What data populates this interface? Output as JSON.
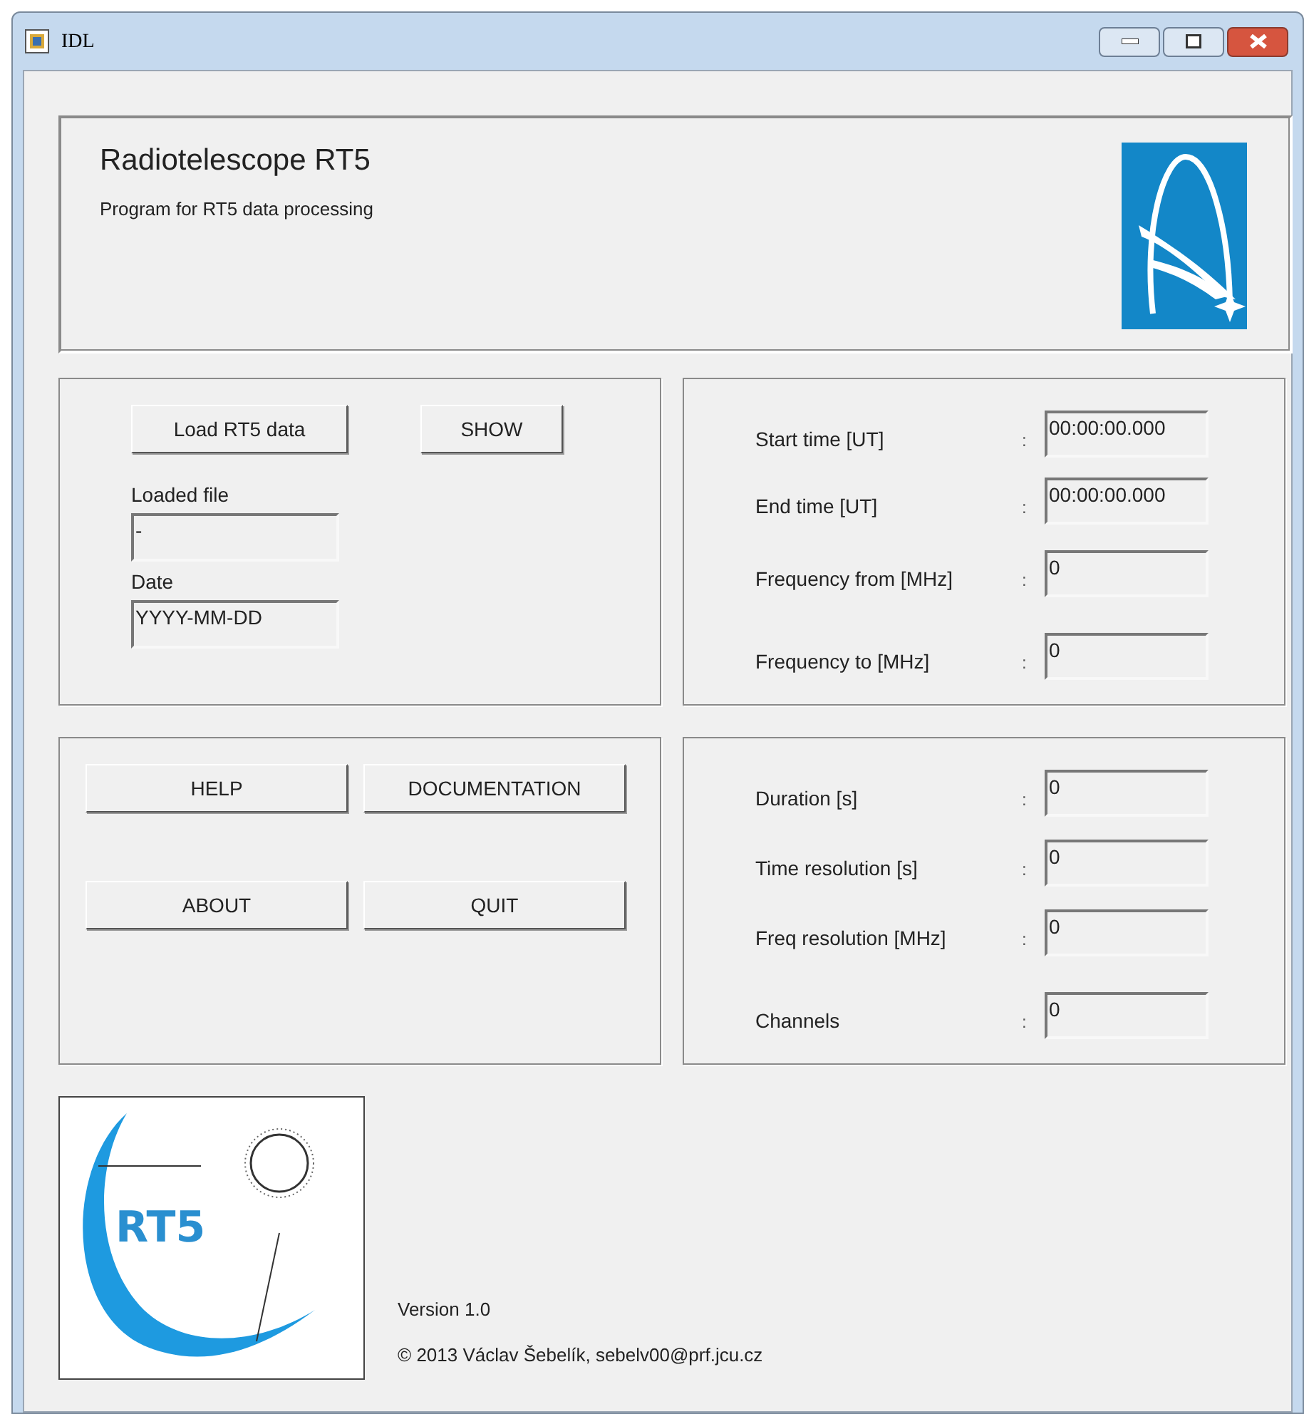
{
  "window": {
    "title": "IDL"
  },
  "header": {
    "title": "Radiotelescope RT5",
    "subtitle": "Program for RT5 data processing"
  },
  "load_panel": {
    "buttons": [
      "Load RT5 data",
      "SHOW"
    ],
    "fields": [
      {
        "label": "Loaded file",
        "value": "-"
      },
      {
        "label": "Date",
        "value": "YYYY-MM-DD"
      }
    ]
  },
  "time_panel": [
    {
      "label": "Start time [UT]",
      "separator": ":",
      "value": "00:00:00.000"
    },
    {
      "label": "End time [UT]",
      "separator": ":",
      "value": "00:00:00.000"
    },
    {
      "label": "Frequency from [MHz]",
      "separator": ":",
      "value": "0"
    },
    {
      "label": "Frequency to [MHz]",
      "separator": ":",
      "value": "0"
    }
  ],
  "action_buttons": [
    "HELP",
    "DOCUMENTATION",
    "ABOUT",
    "QUIT"
  ],
  "info_panel": [
    {
      "label": "Duration [s]",
      "separator": ":",
      "value": "0"
    },
    {
      "label": "Time resolution [s]",
      "separator": ":",
      "value": "0"
    },
    {
      "label": "Freq resolution [MHz]",
      "separator": ":",
      "value": "0"
    },
    {
      "label": "Channels",
      "separator": ":",
      "value": "0"
    }
  ],
  "footer": {
    "logo_text": "RT5",
    "version": "Version 1.0",
    "copyright": "© 2013 Václav Šebelík, sebelv00@prf.jcu.cz"
  }
}
